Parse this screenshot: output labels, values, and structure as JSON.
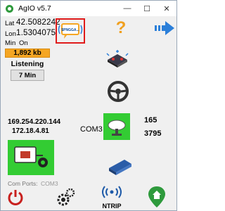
{
  "window": {
    "title": "AgIO v5.7",
    "controls": {
      "minimize": "—",
      "maximize": "☐",
      "close": "✕"
    }
  },
  "position": {
    "lat_label": "Lat",
    "lat_value": "42.5082242",
    "lon_label": "Lon",
    "lon_value": "1.5304075",
    "flags": [
      "Min",
      "On"
    ]
  },
  "status": {
    "data_rate": "1,892 kb",
    "state": "Listening",
    "interval_button": "7 Min"
  },
  "network": {
    "ip1": "169.254.220.144",
    "ip2": "172.18.4.81"
  },
  "gps": {
    "port": "COM3",
    "value1": "165",
    "value2": "3795"
  },
  "bottom": {
    "com_ports_label": "Com Ports:",
    "com_ports_value": "COM3",
    "ntrip_label": "NTRIP",
    "nmea_icon_text": "$PNGGA..."
  },
  "colors": {
    "accent_orange": "#f5a623",
    "gps_green": "#33cc33",
    "highlight_red": "#e01b1b",
    "arrow_blue": "#2b7fd9"
  }
}
